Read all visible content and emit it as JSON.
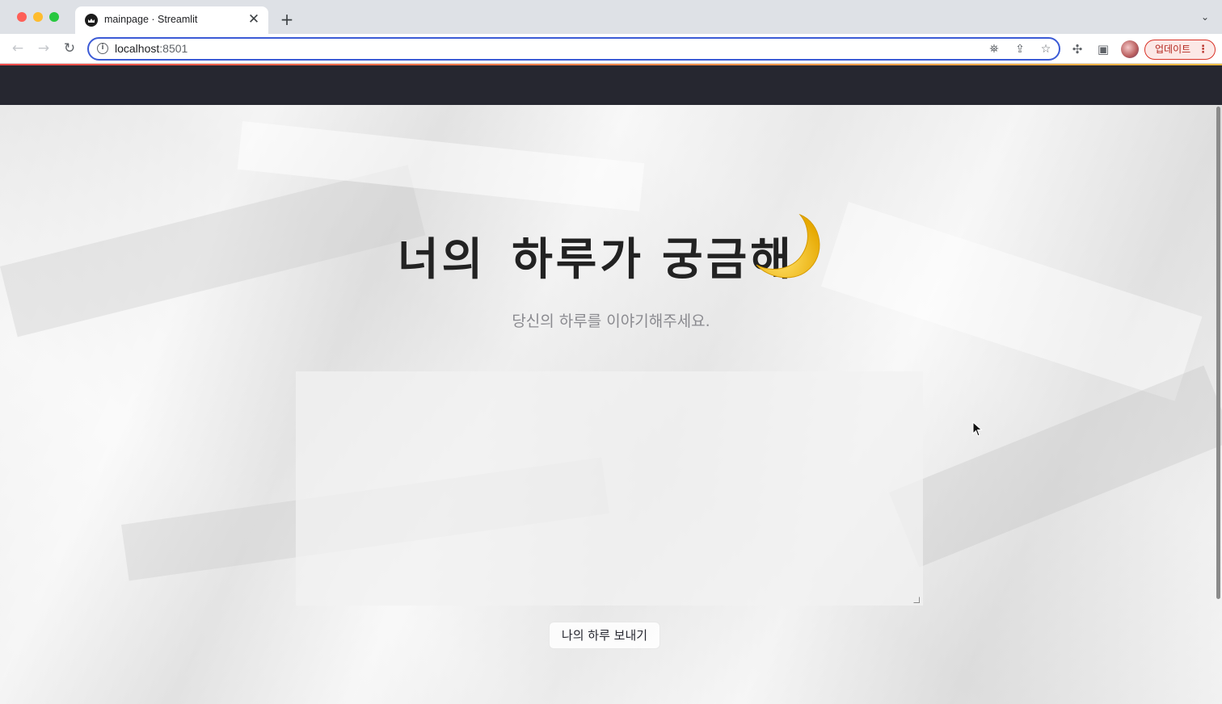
{
  "browser": {
    "tab_title": "mainpage · Streamlit",
    "tab_close": "✕",
    "new_tab": "+",
    "tab_menu": "⌄",
    "url_host": "localhost",
    "url_port": ":8501",
    "update_label": "업데이트",
    "update_more": "⋮",
    "nav_back": "←",
    "nav_forward": "→",
    "nav_reload": "↻",
    "info_glyph": "i",
    "translate_glyph": "⛯",
    "share_glyph": "⇪",
    "star_glyph": "☆",
    "extensions_glyph": "✣",
    "sidepanel_glyph": "▣"
  },
  "page": {
    "title_words": [
      "너의",
      "하루가",
      "궁금해"
    ],
    "title_emoji": "crescent-moon",
    "subtitle": "당신의 하루를 이야기해주세요.",
    "textarea_value": "",
    "send_button_label": "나의 하루 보내기"
  },
  "colors": {
    "streamlit_header": "#262730",
    "omnibox_focus": "#3c5bd6",
    "update_border": "#d93025",
    "moon": "#f5c518"
  }
}
